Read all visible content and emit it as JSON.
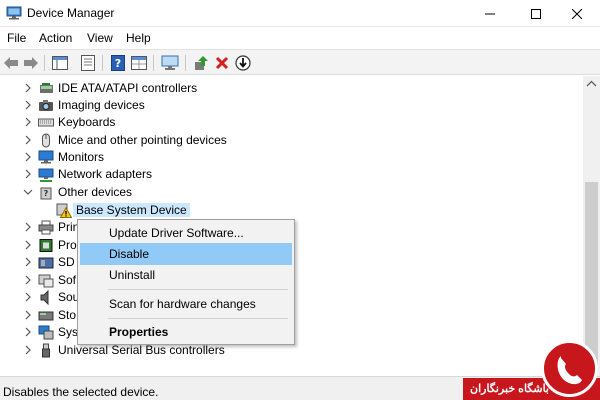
{
  "window": {
    "title": "Device Manager"
  },
  "menu": [
    "File",
    "Action",
    "View",
    "Help"
  ],
  "tree": [
    {
      "label": "IDE ATA/ATAPI controllers",
      "icon": "ide-controller-icon",
      "expanded": false
    },
    {
      "label": "Imaging devices",
      "icon": "camera-icon",
      "expanded": false
    },
    {
      "label": "Keyboards",
      "icon": "keyboard-icon",
      "expanded": false
    },
    {
      "label": "Mice and other pointing devices",
      "icon": "mouse-icon",
      "expanded": false
    },
    {
      "label": "Monitors",
      "icon": "monitor-icon",
      "expanded": false
    },
    {
      "label": "Network adapters",
      "icon": "network-adapter-icon",
      "expanded": false
    },
    {
      "label": "Other devices",
      "icon": "unknown-device-icon",
      "expanded": true
    },
    {
      "label": "Base System Device",
      "icon": "warning-device-icon",
      "child": true,
      "selected": true
    },
    {
      "label": "Prin",
      "icon": "printer-icon",
      "expanded": false
    },
    {
      "label": "Pro",
      "icon": "processor-icon",
      "expanded": false
    },
    {
      "label": "SD",
      "icon": "sd-host-icon",
      "expanded": false
    },
    {
      "label": "Sof",
      "icon": "software-device-icon",
      "expanded": false
    },
    {
      "label": "Sou",
      "icon": "speaker-icon",
      "expanded": false
    },
    {
      "label": "Sto",
      "icon": "storage-icon",
      "expanded": false
    },
    {
      "label": "Syst",
      "icon": "system-devices-icon",
      "expanded": false
    },
    {
      "label": "Universal Serial Bus controllers",
      "icon": "usb-icon",
      "expanded": false
    }
  ],
  "context_menu": {
    "items": [
      {
        "label": "Update Driver Software...",
        "highlighted": false,
        "bold": false
      },
      {
        "label": "Disable",
        "highlighted": true,
        "bold": false
      },
      {
        "label": "Uninstall",
        "highlighted": false,
        "bold": false
      },
      {
        "label": "Scan for hardware changes",
        "highlighted": false,
        "bold": false
      },
      {
        "label": "Properties",
        "highlighted": false,
        "bold": true
      }
    ]
  },
  "status": {
    "text": "Disables the selected device."
  },
  "watermark": {
    "text": "باشگاه خبرنگاران"
  },
  "colors": {
    "highlight": "#91c9f7",
    "selection": "#cce8ff",
    "watermark_red": "#c8161d"
  }
}
